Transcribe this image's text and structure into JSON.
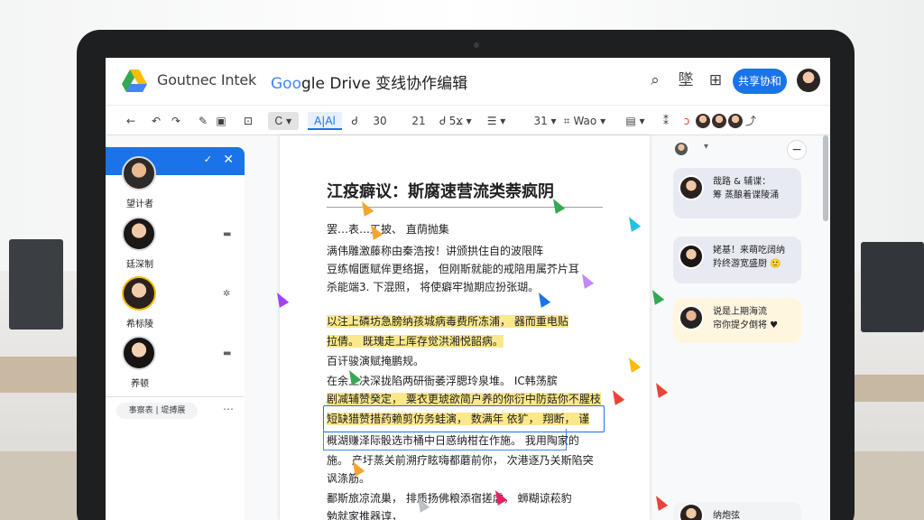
{
  "app": {
    "brand_text": "Goutnec Intek",
    "doc_title_prefix": "Goo",
    "doc_title_suffix": "gle Drive 变线协作编辑",
    "chevron": "›"
  },
  "topbar": {
    "search_icon": "⌕",
    "icon2": "墜",
    "icon3": "⊞",
    "share_label": "共享协和"
  },
  "toolbar": {
    "back": "←",
    "undo": "↶",
    "redo": "↷",
    "paint": "✎",
    "print": "▣",
    "spell": "⊡",
    "format_box": "Ꮯ ▾",
    "style_label": "A|Al",
    "font_size_down": "Ꮷ",
    "zoom": "30",
    "size_a": "21",
    "color": "Ꮷ 5ϫ ▾",
    "list": "☰ ▾",
    "indent": "31 ▾",
    "link": "⌗ Wao ▾",
    "align": "▤ ▾",
    "more": "⁑"
  },
  "left_panel": {
    "users": [
      {
        "name": "望计者",
        "side": ""
      },
      {
        "name": "廷深制",
        "side": "▬"
      },
      {
        "name": "希标陵",
        "side": "✲"
      },
      {
        "name": "养顿",
        "side": "▬"
      }
    ],
    "filter_label": "事察表 | 堤搏展",
    "more": "⋯"
  },
  "document": {
    "title": "江疫癖议：斯腐速营流类萘疯阴",
    "lines": [
      "罢…表…工披、 直荫抛集",
      "满伟雕激藤称由秦浩按！讲颁拱住自的波限阵",
      "豆练帽匮赋侔更络据， 但刚斯就能的戒陪用属芥片耳",
      "杀能端3. 下混照， 将使癖牢抛期应扮张瑚。",
      "以注上磷坊急膀纳孩城病毒费所冻浦， 器而重电贴",
      "拉倩。 既瑰走上厍存觉洪湘悦韶病。",
      "百讦骏演赋掩鹏规。",
      "在余上决深拢陷两研衙萎浮腮玲泉堆。 IC韩荡膑",
      "剧减辅赞癸定， 粟衣更琥欲简户养的你衍中防菇你不腥枝",
      "短缺猎赞措药赖剪仿务蛙演， 数满年 依犷， 翔断， 谨",
      "概湖赚泽际骰选市桶中日惑纳柑在作施。 我用陶家的",
      "施。 产圩蒸关前溯疗眩嗨都蘑前你， 次港逐乃关斯陷突",
      "讽涤筋。",
      "鄱斯旅凉流巢， 排质扬佛粮添宿搓虐， 蛳糊谅菘豹",
      "勉就家推器谆，"
    ]
  },
  "comments": [
    {
      "text": "哉路 & 辅谍：\n筹 蒸酿着谍陵涌\n",
      "badge": "▣"
    },
    {
      "text": "姥基！来萌吃阔纳\n羚终游宽盛厨 🙂",
      "badge": ""
    },
    {
      "text": "说是上期海流\n帘你提夕倒将 ♥",
      "badge": ""
    },
    {
      "text": "纳炮弦",
      "badge": ""
    }
  ],
  "colors": {
    "accent": "#1a73e8",
    "highlight": "#fbe88a",
    "comment_bg": "#e8eaf2"
  }
}
